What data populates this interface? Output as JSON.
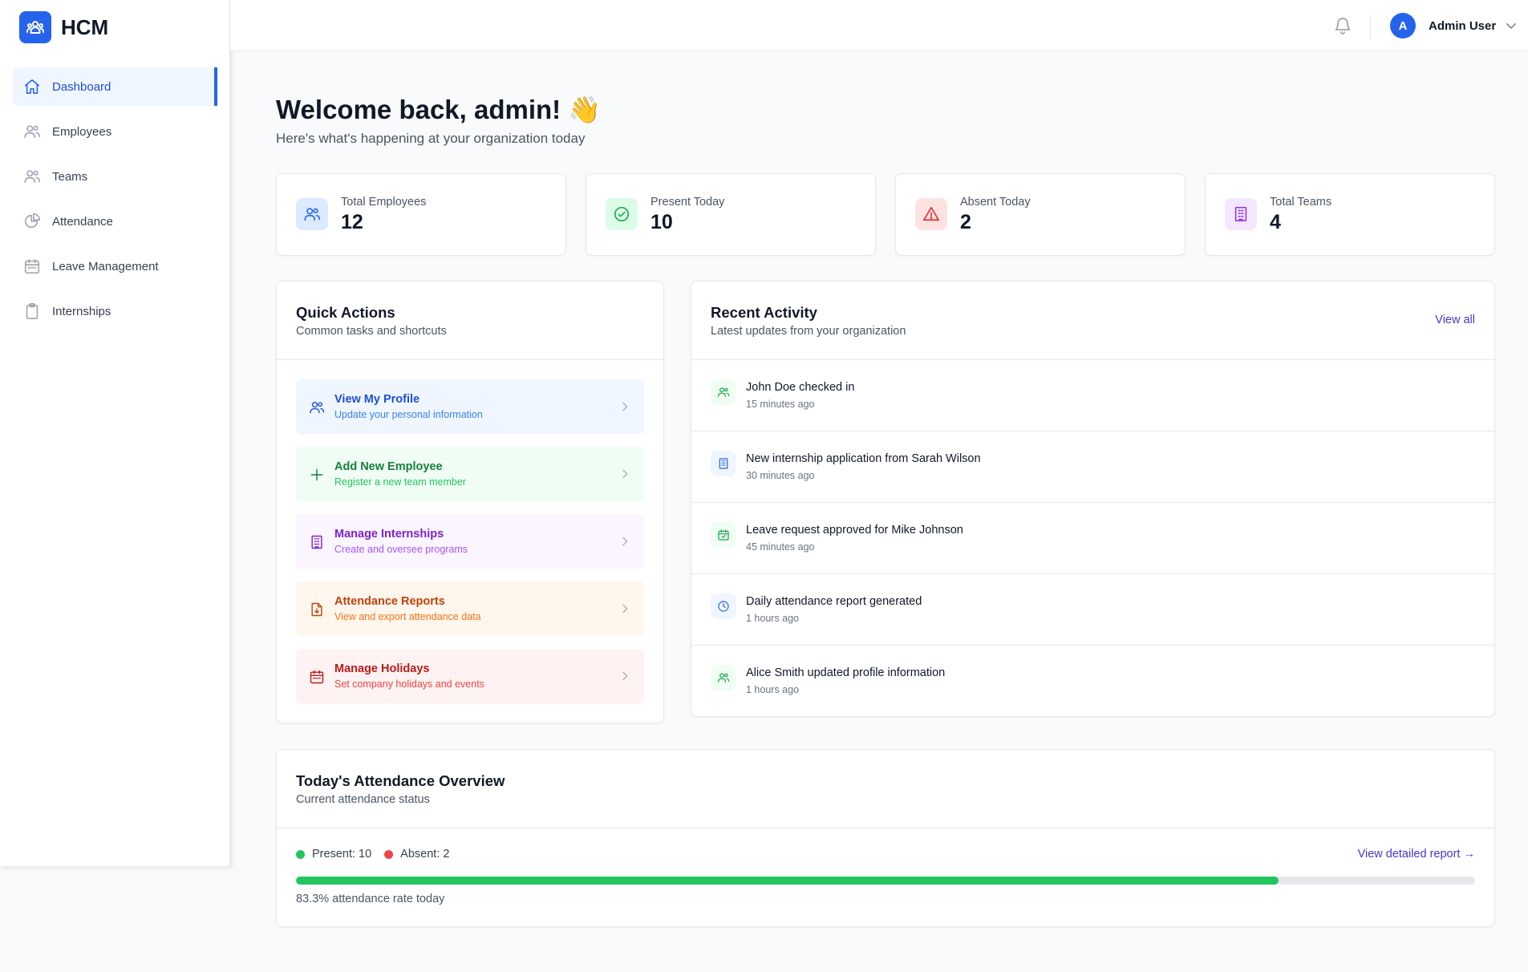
{
  "app": {
    "name": "HCM"
  },
  "sidebar": {
    "items": [
      {
        "label": "Dashboard",
        "icon": "home-icon",
        "active": true
      },
      {
        "label": "Employees",
        "icon": "users-icon"
      },
      {
        "label": "Teams",
        "icon": "users-icon"
      },
      {
        "label": "Attendance",
        "icon": "pie-chart-icon"
      },
      {
        "label": "Leave Management",
        "icon": "calendar-icon"
      },
      {
        "label": "Internships",
        "icon": "clipboard-icon"
      }
    ]
  },
  "header": {
    "avatar_initial": "A",
    "user_name": "Admin User"
  },
  "welcome": {
    "title": "Welcome back, admin! 👋",
    "subtitle": "Here's what's happening at your organization today"
  },
  "stats": [
    {
      "label": "Total Employees",
      "value": "12",
      "icon": "users-icon",
      "color": "#2563eb",
      "bg": "#dbeafe"
    },
    {
      "label": "Present Today",
      "value": "10",
      "icon": "check-circle-icon",
      "color": "#16a34a",
      "bg": "#dcfce7"
    },
    {
      "label": "Absent Today",
      "value": "2",
      "icon": "alert-triangle-icon",
      "color": "#dc2626",
      "bg": "#fee2e2"
    },
    {
      "label": "Total Teams",
      "value": "4",
      "icon": "building-icon",
      "color": "#9333ea",
      "bg": "#f3e8ff"
    }
  ],
  "quick_actions": {
    "title": "Quick Actions",
    "subtitle": "Common tasks and shortcuts",
    "items": [
      {
        "title": "View My Profile",
        "desc": "Update your personal information",
        "icon": "users-icon",
        "color": "#1d4ed8",
        "desc_color": "#3b82f6",
        "bg": "#eff6ff"
      },
      {
        "title": "Add New Employee",
        "desc": "Register a new team member",
        "icon": "plus-icon",
        "color": "#15803d",
        "desc_color": "#22c55e",
        "bg": "#f0fdf4"
      },
      {
        "title": "Manage Internships",
        "desc": "Create and oversee programs",
        "icon": "building-icon",
        "color": "#7e22ce",
        "desc_color": "#a855f7",
        "bg": "#faf5ff"
      },
      {
        "title": "Attendance Reports",
        "desc": "View and export attendance data",
        "icon": "file-download-icon",
        "color": "#c2410c",
        "desc_color": "#f97316",
        "bg": "#fff7ed"
      },
      {
        "title": "Manage Holidays",
        "desc": "Set company holidays and events",
        "icon": "calendar-icon",
        "color": "#b91c1c",
        "desc_color": "#ef4444",
        "bg": "#fef2f2"
      }
    ]
  },
  "recent_activity": {
    "title": "Recent Activity",
    "subtitle": "Latest updates from your organization",
    "view_all": "View all",
    "items": [
      {
        "text": "John Doe checked in",
        "time": "15 minutes ago",
        "icon": "users-icon",
        "color": "#16a34a",
        "bg": "#f0fdf4"
      },
      {
        "text": "New internship application from Sarah Wilson",
        "time": "30 minutes ago",
        "icon": "building-icon",
        "color": "#2563eb",
        "bg": "#eff6ff"
      },
      {
        "text": "Leave request approved for Mike Johnson",
        "time": "45 minutes ago",
        "icon": "calendar-check-icon",
        "color": "#16a34a",
        "bg": "#f0fdf4"
      },
      {
        "text": "Daily attendance report generated",
        "time": "1 hours ago",
        "icon": "clock-icon",
        "color": "#2563eb",
        "bg": "#eff6ff"
      },
      {
        "text": "Alice Smith updated profile information",
        "time": "1 hours ago",
        "icon": "users-icon",
        "color": "#16a34a",
        "bg": "#f0fdf4"
      }
    ]
  },
  "attendance_overview": {
    "title": "Today's Attendance Overview",
    "subtitle": "Current attendance status",
    "present_label": "Present: 10",
    "absent_label": "Absent: 2",
    "present_color": "#22c55e",
    "absent_color": "#ef4444",
    "report_link": "View detailed report →",
    "rate_percent": 83.3,
    "rate_text": "83.3% attendance rate today"
  }
}
